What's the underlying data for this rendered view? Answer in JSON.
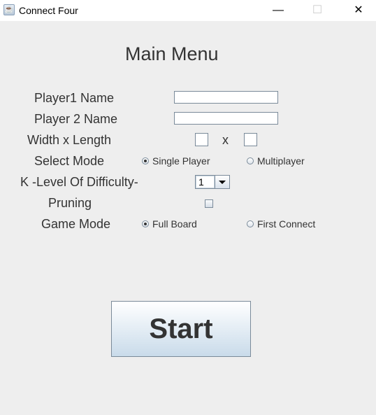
{
  "window": {
    "title": "Connect Four",
    "icon": "java-icon",
    "minimize": "—",
    "maximize": "☐",
    "close": "✕"
  },
  "heading": "Main Menu",
  "labels": {
    "player1": "Player1 Name",
    "player2": "Player 2 Name",
    "size": "Width x Length",
    "size_x": "x",
    "mode": "Select Mode",
    "difficulty": "K -Level Of Difficulty-",
    "pruning": "Pruning",
    "game_mode": "Game Mode"
  },
  "inputs": {
    "player1": "",
    "player2": "",
    "width": "",
    "length": ""
  },
  "select_mode": {
    "options": [
      "Single Player",
      "Multiplayer"
    ],
    "selected": "Single Player"
  },
  "difficulty": {
    "selected": "1"
  },
  "pruning": {
    "checked": false
  },
  "game_mode": {
    "options": [
      "Full Board",
      "First Connect"
    ],
    "selected": "Full Board"
  },
  "start_label": "Start"
}
